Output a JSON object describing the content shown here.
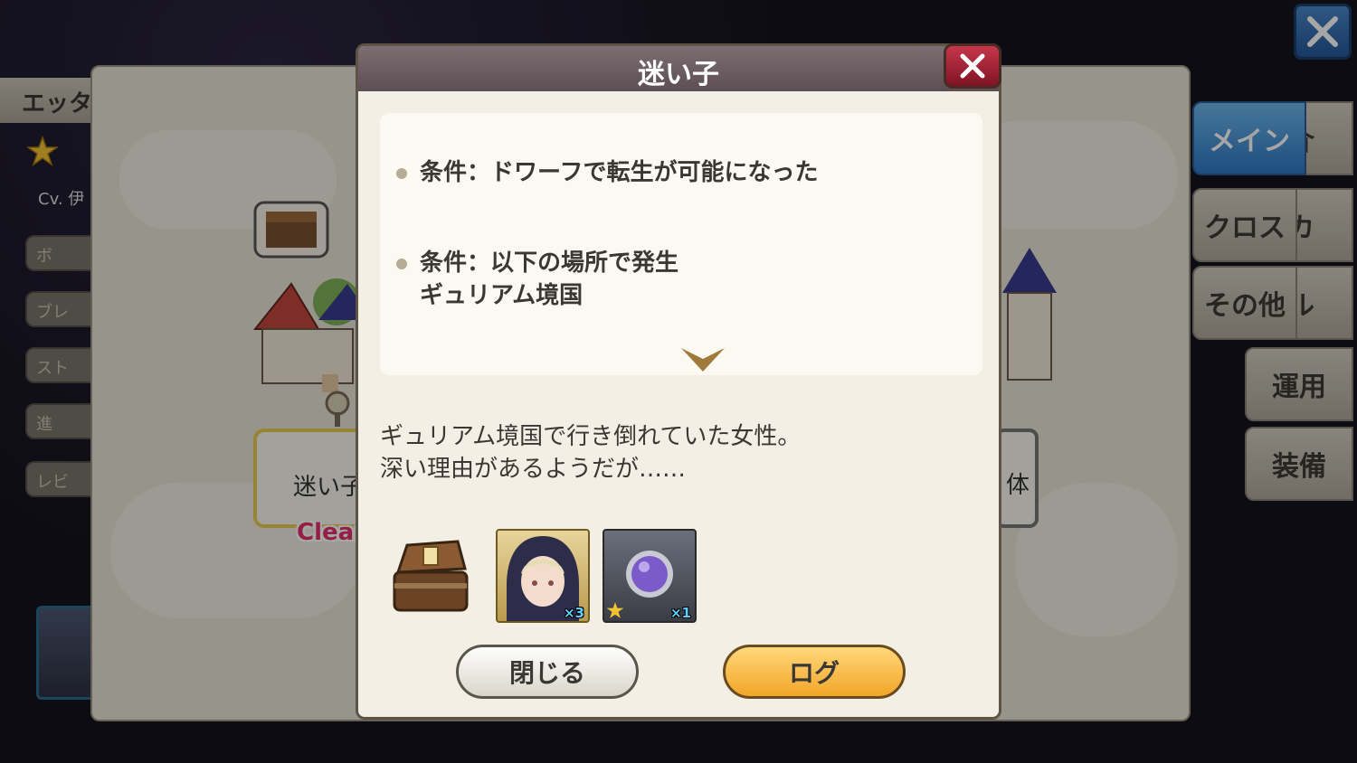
{
  "background": {
    "left_header": "エッタ",
    "left_cv": "Cv. 伊",
    "left_tabs": [
      "ボ",
      "ブレ",
      "スト",
      "進",
      "レビ"
    ],
    "map_node_label": "迷い子",
    "map_node_status": "Clear",
    "right_node_label": "体",
    "right_tabs": [
      "メイン",
      "クロス",
      "その他",
      "運用",
      "装備"
    ],
    "right_tabs_behind": [
      "介",
      "カ",
      "ル"
    ]
  },
  "dialog": {
    "title": "迷い子",
    "conditions": [
      {
        "label": "条件：ドワーフで転生が可能になった"
      },
      {
        "label": "条件：以下の場所で発生",
        "detail": "ギュリアム境国"
      }
    ],
    "description_lines": [
      "ギュリアム境国で行き倒れていた女性。",
      "深い理由があるようだが……"
    ],
    "rewards": [
      {
        "icon": "hooded-character-portrait",
        "quantity": "×3"
      },
      {
        "icon": "purple-orb",
        "quantity": "×1"
      }
    ],
    "buttons": {
      "close": "閉じる",
      "log": "ログ"
    }
  },
  "colors": {
    "title_bar": "#6b5d61",
    "close_red": "#b52a3e",
    "log_button": "#f6b84a",
    "accent_blue": "#3b8ad6",
    "clear_pink": "#e4306b"
  }
}
